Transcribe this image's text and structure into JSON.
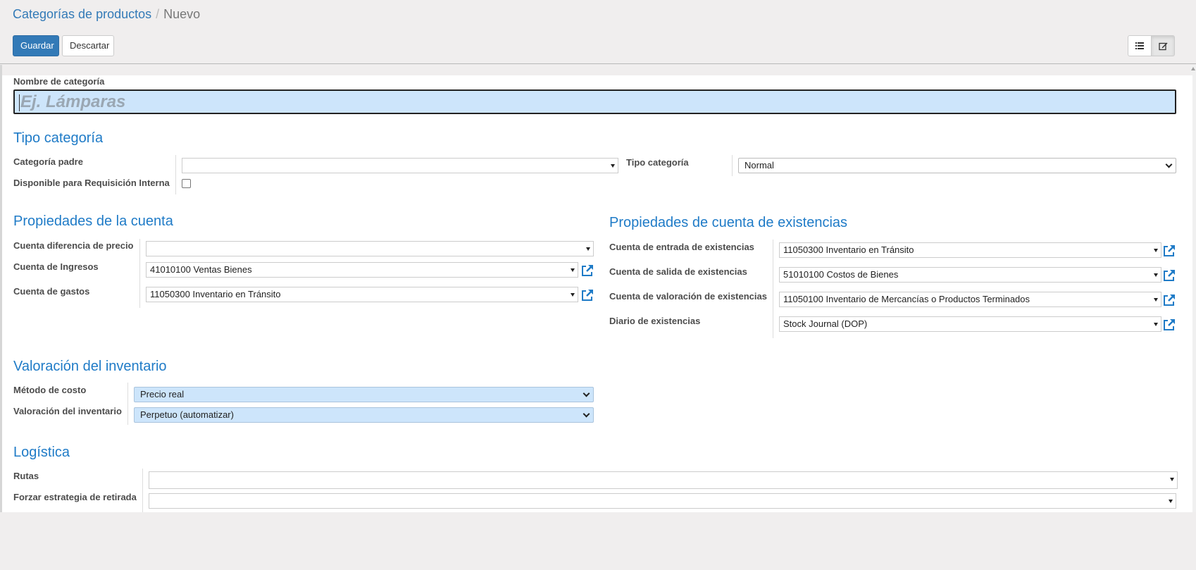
{
  "breadcrumb": {
    "parent": "Categorías de productos",
    "separator": "/",
    "current": "Nuevo"
  },
  "buttons": {
    "save": "Guardar",
    "discard": "Descartar"
  },
  "view_switcher": {
    "list_icon": "list-icon",
    "form_icon": "edit-icon",
    "active": "form"
  },
  "form": {
    "name_label": "Nombre de categoría",
    "name_placeholder": "Ej. Lámparas",
    "section_tipo": {
      "title": "Tipo categoría",
      "parent_label": "Categoría padre",
      "parent_value": "",
      "available_label": "Disponible para Requisición Interna",
      "available_checked": false,
      "type_label": "Tipo categoría",
      "type_value": "Normal"
    },
    "section_cuenta": {
      "title": "Propiedades de la cuenta",
      "fields": [
        {
          "label": "Cuenta diferencia de precio",
          "value": ""
        },
        {
          "label": "Cuenta de Ingresos",
          "value": "41010100 Ventas Bienes"
        },
        {
          "label": "Cuenta de gastos",
          "value": "11050300 Inventario en Tránsito"
        }
      ]
    },
    "section_existencias": {
      "title": "Propiedades de cuenta de existencias",
      "fields": [
        {
          "label": "Cuenta de entrada de existencias",
          "value": "11050300 Inventario en Tránsito"
        },
        {
          "label": "Cuenta de salida de existencias",
          "value": "51010100 Costos de Bienes"
        },
        {
          "label": "Cuenta de valoración de existencias",
          "value": "11050100 Inventario de Mercancías o Productos Terminados"
        },
        {
          "label": "Diario de existencias",
          "value": "Stock Journal (DOP)"
        }
      ]
    },
    "section_valoracion": {
      "title": "Valoración del inventario",
      "cost_method_label": "Método de costo",
      "cost_method_value": "Precio real",
      "valuation_label": "Valoración del inventario",
      "valuation_value": "Perpetuo (automatizar)"
    },
    "section_logistica": {
      "title": "Logística",
      "routes_label": "Rutas",
      "routes_value": "",
      "removal_label": "Forzar estrategia de retirada",
      "removal_value": ""
    }
  },
  "colors": {
    "accent": "#337ab7",
    "section_title": "#1f7bc7",
    "highlight": "#cde5fb",
    "link_icon": "#1f7bc7"
  }
}
